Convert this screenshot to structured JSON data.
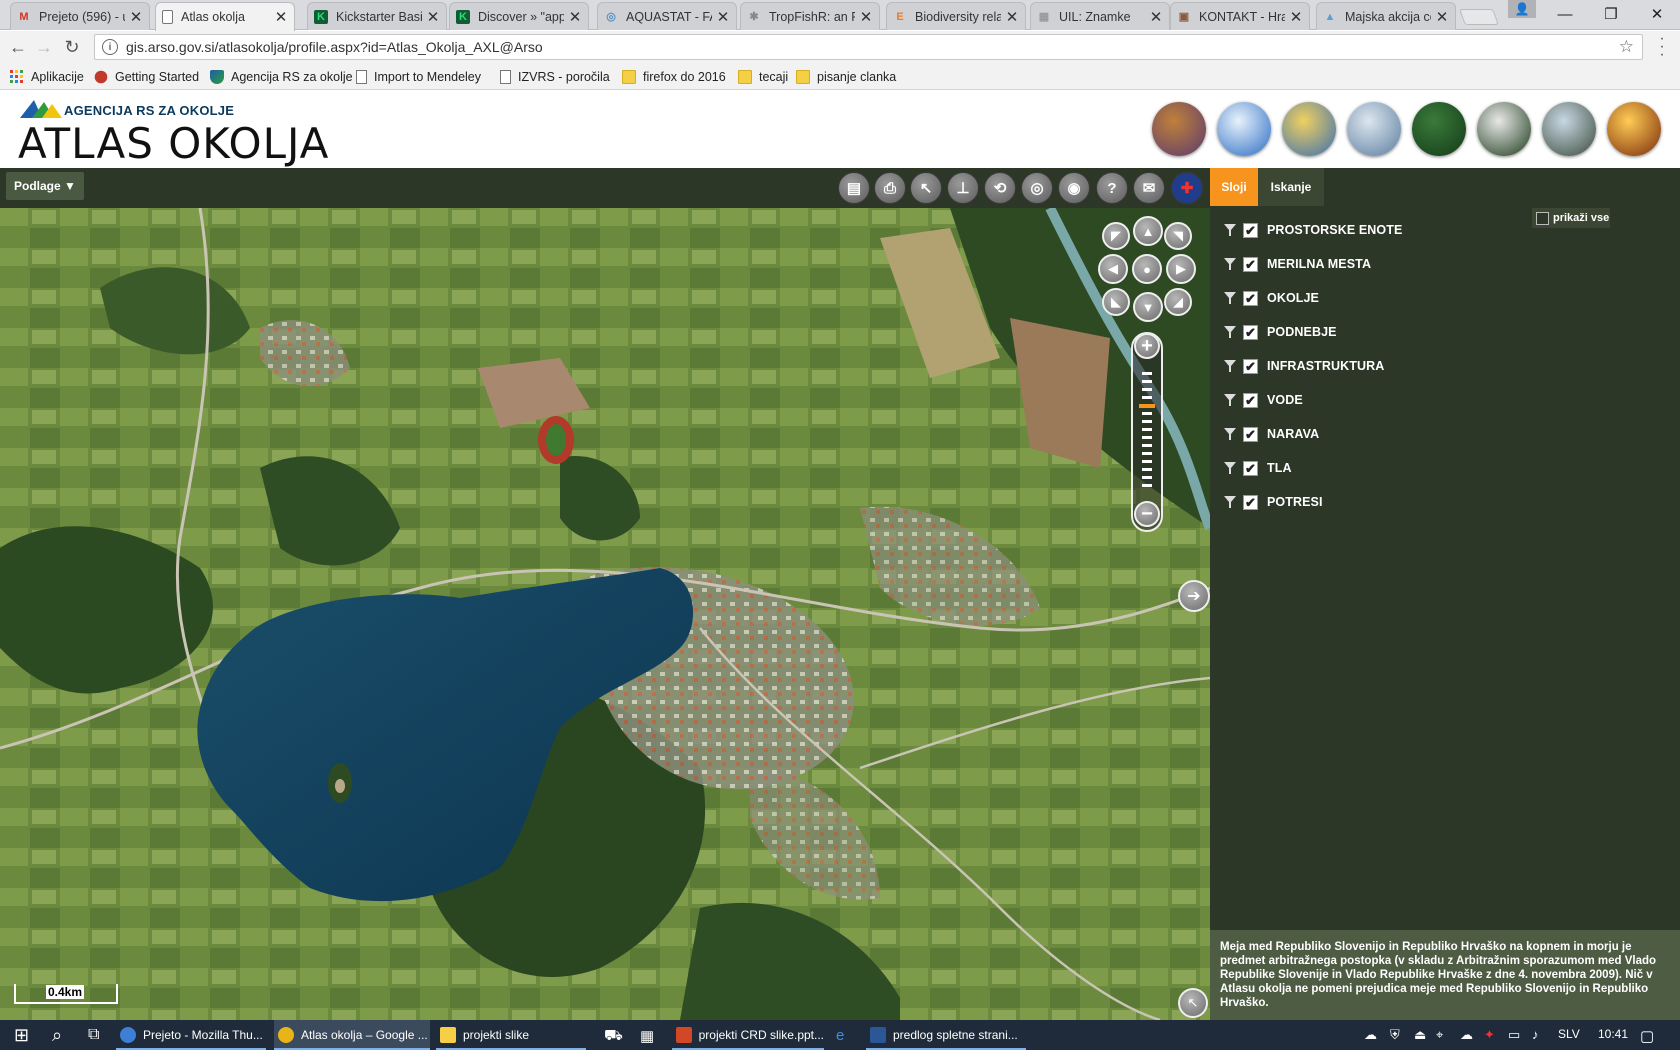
{
  "browser": {
    "tabs": [
      {
        "title": "Prejeto (596) - u",
        "icon": "gmail-icon",
        "icon_char": "M",
        "icon_color": "#d93025"
      },
      {
        "title": "Atlas okolja",
        "icon": "page-icon",
        "icon_char": "",
        "icon_color": "#777"
      },
      {
        "title": "Kickstarter Basic",
        "icon": "kickstarter-icon",
        "icon_char": "K",
        "icon_color": "#2bde73"
      },
      {
        "title": "Discover » \"app",
        "icon": "kickstarter-icon",
        "icon_char": "K",
        "icon_color": "#2bde73"
      },
      {
        "title": "AQUASTAT - FA",
        "icon": "fao-icon",
        "icon_char": "◎",
        "icon_color": "#5b8fc7"
      },
      {
        "title": "TropFishR: an R",
        "icon": "r-icon",
        "icon_char": "✱",
        "icon_color": "#888"
      },
      {
        "title": "Biodiversity rela",
        "icon": "elsevier-icon",
        "icon_char": "E",
        "icon_color": "#f07c21"
      },
      {
        "title": "UIL: Znamke",
        "icon": "grid-icon",
        "icon_char": "▦",
        "icon_color": "#999"
      },
      {
        "title": "KONTAKT - Hra",
        "icon": "site-icon",
        "icon_char": "▣",
        "icon_color": "#8a5a3a"
      },
      {
        "title": "Majska akcija ce",
        "icon": "image-icon",
        "icon_char": "▲",
        "icon_color": "#5a9fd4"
      }
    ],
    "active_tab_index": 1,
    "close_glyph": "✕",
    "window_controls": {
      "minimize": "—",
      "restore": "❐",
      "close": "✕"
    },
    "url": "gis.arso.gov.si/atlasokolja/profile.aspx?id=Atlas_Okolja_AXL@Arso",
    "bookmarks": [
      {
        "label": "Aplikacije",
        "icon": "apps-icon"
      },
      {
        "label": "Getting Started",
        "icon": "firefox-icon"
      },
      {
        "label": "Agencija RS za okolje",
        "icon": "arso-icon"
      },
      {
        "label": "Import to Mendeley",
        "icon": "page-icon"
      },
      {
        "label": "IZVRS - poročila",
        "icon": "page-icon"
      },
      {
        "label": "firefox do 2016",
        "icon": "folder-icon"
      },
      {
        "label": "tecaji",
        "icon": "folder-icon"
      },
      {
        "label": "pisanje clanka",
        "icon": "folder-icon"
      }
    ]
  },
  "site": {
    "agency": "AGENCIJA RS ZA OKOLJE",
    "title": "ATLAS OKOLJA",
    "theme_circles": [
      {
        "name": "theme-slovenia-map",
        "colors": [
          "#c0813a",
          "#5b3a6e"
        ]
      },
      {
        "name": "theme-sky-clouds",
        "colors": [
          "#e8f2fb",
          "#2b6cc4"
        ]
      },
      {
        "name": "theme-field",
        "colors": [
          "#f0d060",
          "#3a6fb0"
        ]
      },
      {
        "name": "theme-frost-tree",
        "colors": [
          "#dde6ee",
          "#5a7da0"
        ]
      },
      {
        "name": "theme-forest",
        "colors": [
          "#3b7a3a",
          "#123a18"
        ]
      },
      {
        "name": "theme-dandelion",
        "colors": [
          "#e8e8e8",
          "#1d3b1a"
        ]
      },
      {
        "name": "theme-lake",
        "colors": [
          "#c8d8e4",
          "#3a4a3a"
        ]
      },
      {
        "name": "theme-fire",
        "colors": [
          "#ffcc55",
          "#7a2a0a"
        ]
      }
    ]
  },
  "map_toolbar": {
    "basemap_label": "Podlage ▼",
    "tools": [
      {
        "name": "legend-tool-icon",
        "glyph": "▤"
      },
      {
        "name": "print-tool-icon",
        "glyph": "⎙"
      },
      {
        "name": "select-tool-icon",
        "glyph": "↖"
      },
      {
        "name": "measure-tool-icon",
        "glyph": "⊥"
      },
      {
        "name": "back-extent-icon",
        "glyph": "⟲"
      },
      {
        "name": "overlay-tool-icon",
        "glyph": "◎"
      },
      {
        "name": "camera-tool-icon",
        "glyph": "◉"
      },
      {
        "name": "help-tool-icon",
        "glyph": "?"
      },
      {
        "name": "mail-tool-icon",
        "glyph": "✉"
      },
      {
        "name": "english-flag-icon",
        "glyph": "✚"
      }
    ]
  },
  "map": {
    "scale_label": "0.4km",
    "pan_glyphs": [
      "◤",
      "▲",
      "◥",
      "◀",
      "●",
      "▶",
      "◣",
      "▼",
      "◢"
    ],
    "zoom_in": "+",
    "zoom_out": "−",
    "expand_arrow": "➔",
    "corner_arrow": "↖"
  },
  "panel": {
    "tabs": [
      {
        "label": "Sloji",
        "active": true
      },
      {
        "label": "Iskanje",
        "active": false
      }
    ],
    "show_all_label": "prikaži vse",
    "layers": [
      {
        "label": "PROSTORSKE ENOTE",
        "checked": true
      },
      {
        "label": "MERILNA MESTA",
        "checked": true
      },
      {
        "label": "OKOLJE",
        "checked": true
      },
      {
        "label": "PODNEBJE",
        "checked": true
      },
      {
        "label": "INFRASTRUKTURA",
        "checked": true
      },
      {
        "label": "VODE",
        "checked": true
      },
      {
        "label": "NARAVA",
        "checked": true
      },
      {
        "label": "TLA",
        "checked": true
      },
      {
        "label": "POTRESI",
        "checked": true
      }
    ],
    "check_glyph": "✔",
    "disclaimer": "Meja med Republiko Slovenijo in Republiko Hrvaško na kopnem in morju je predmet arbitražnega postopka (v skladu z Arbitražnim sporazumom med Vlado Republike Slovenije in Vlado Republike Hrvaške z dne 4. novembra 2009). Nič v Atlasu okolja ne pomeni prejudica meje med Republiko Slovenijo in Republiko Hrvaško."
  },
  "taskbar": {
    "start": "⊞",
    "search": "⌕",
    "task_view": "⧉",
    "apps": [
      {
        "label": "Prejeto - Mozilla Thu...",
        "icon": "thunderbird-icon",
        "color": "#3d7fd6",
        "active": false
      },
      {
        "label": "Atlas okolja – Google ...",
        "icon": "chrome-icon",
        "color": "#e8b517",
        "active": true
      },
      {
        "label": "projekti slike",
        "icon": "folder-icon",
        "color": "#f5cf45",
        "active": false
      },
      {
        "label": "projekti CRD slike.ppt...",
        "icon": "powerpoint-icon",
        "color": "#d24726",
        "active": false
      },
      {
        "label": "predlog spletne strani...",
        "icon": "word-icon",
        "color": "#2b5797",
        "active": false
      }
    ],
    "language": "SLV",
    "time": "10:41"
  }
}
